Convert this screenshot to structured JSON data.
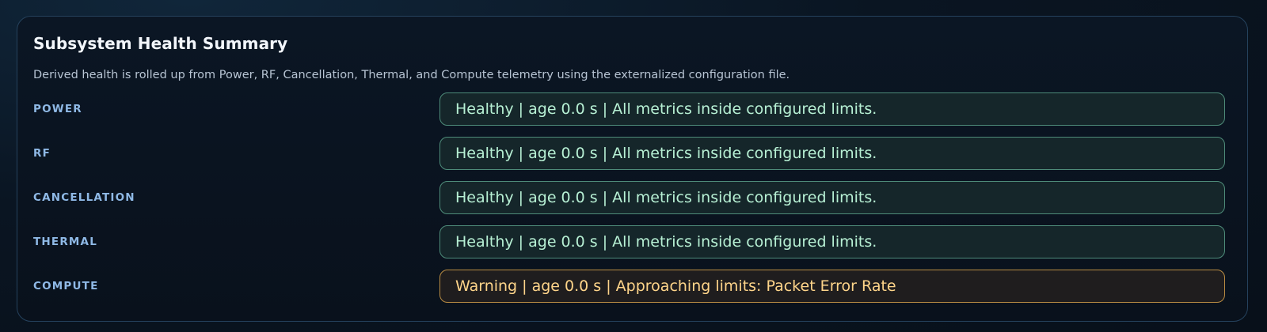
{
  "panel": {
    "title": "Subsystem Health Summary",
    "subtitle": "Derived health is rolled up from Power, RF, Cancellation, Thermal, and Compute telemetry using the externalized configuration file."
  },
  "subsystems": [
    {
      "label": "POWER",
      "status": "Healthy",
      "status_text": "Healthy | age 0.0 s | All metrics inside configured limits."
    },
    {
      "label": "RF",
      "status": "Healthy",
      "status_text": "Healthy | age 0.0 s | All metrics inside configured limits."
    },
    {
      "label": "CANCELLATION",
      "status": "Healthy",
      "status_text": "Healthy | age 0.0 s | All metrics inside configured limits."
    },
    {
      "label": "THERMAL",
      "status": "Healthy",
      "status_text": "Healthy | age 0.0 s | All metrics inside configured limits."
    },
    {
      "label": "COMPUTE",
      "status": "Warning",
      "status_text": "Warning | age 0.0 s | Approaching limits: Packet Error Rate"
    }
  ],
  "colors": {
    "healthy_text": "#b7f0d4",
    "healthy_border": "#4e8c7a",
    "warning_text": "#ffd58a",
    "warning_border": "#b98c43",
    "label": "#8fb9e6"
  }
}
